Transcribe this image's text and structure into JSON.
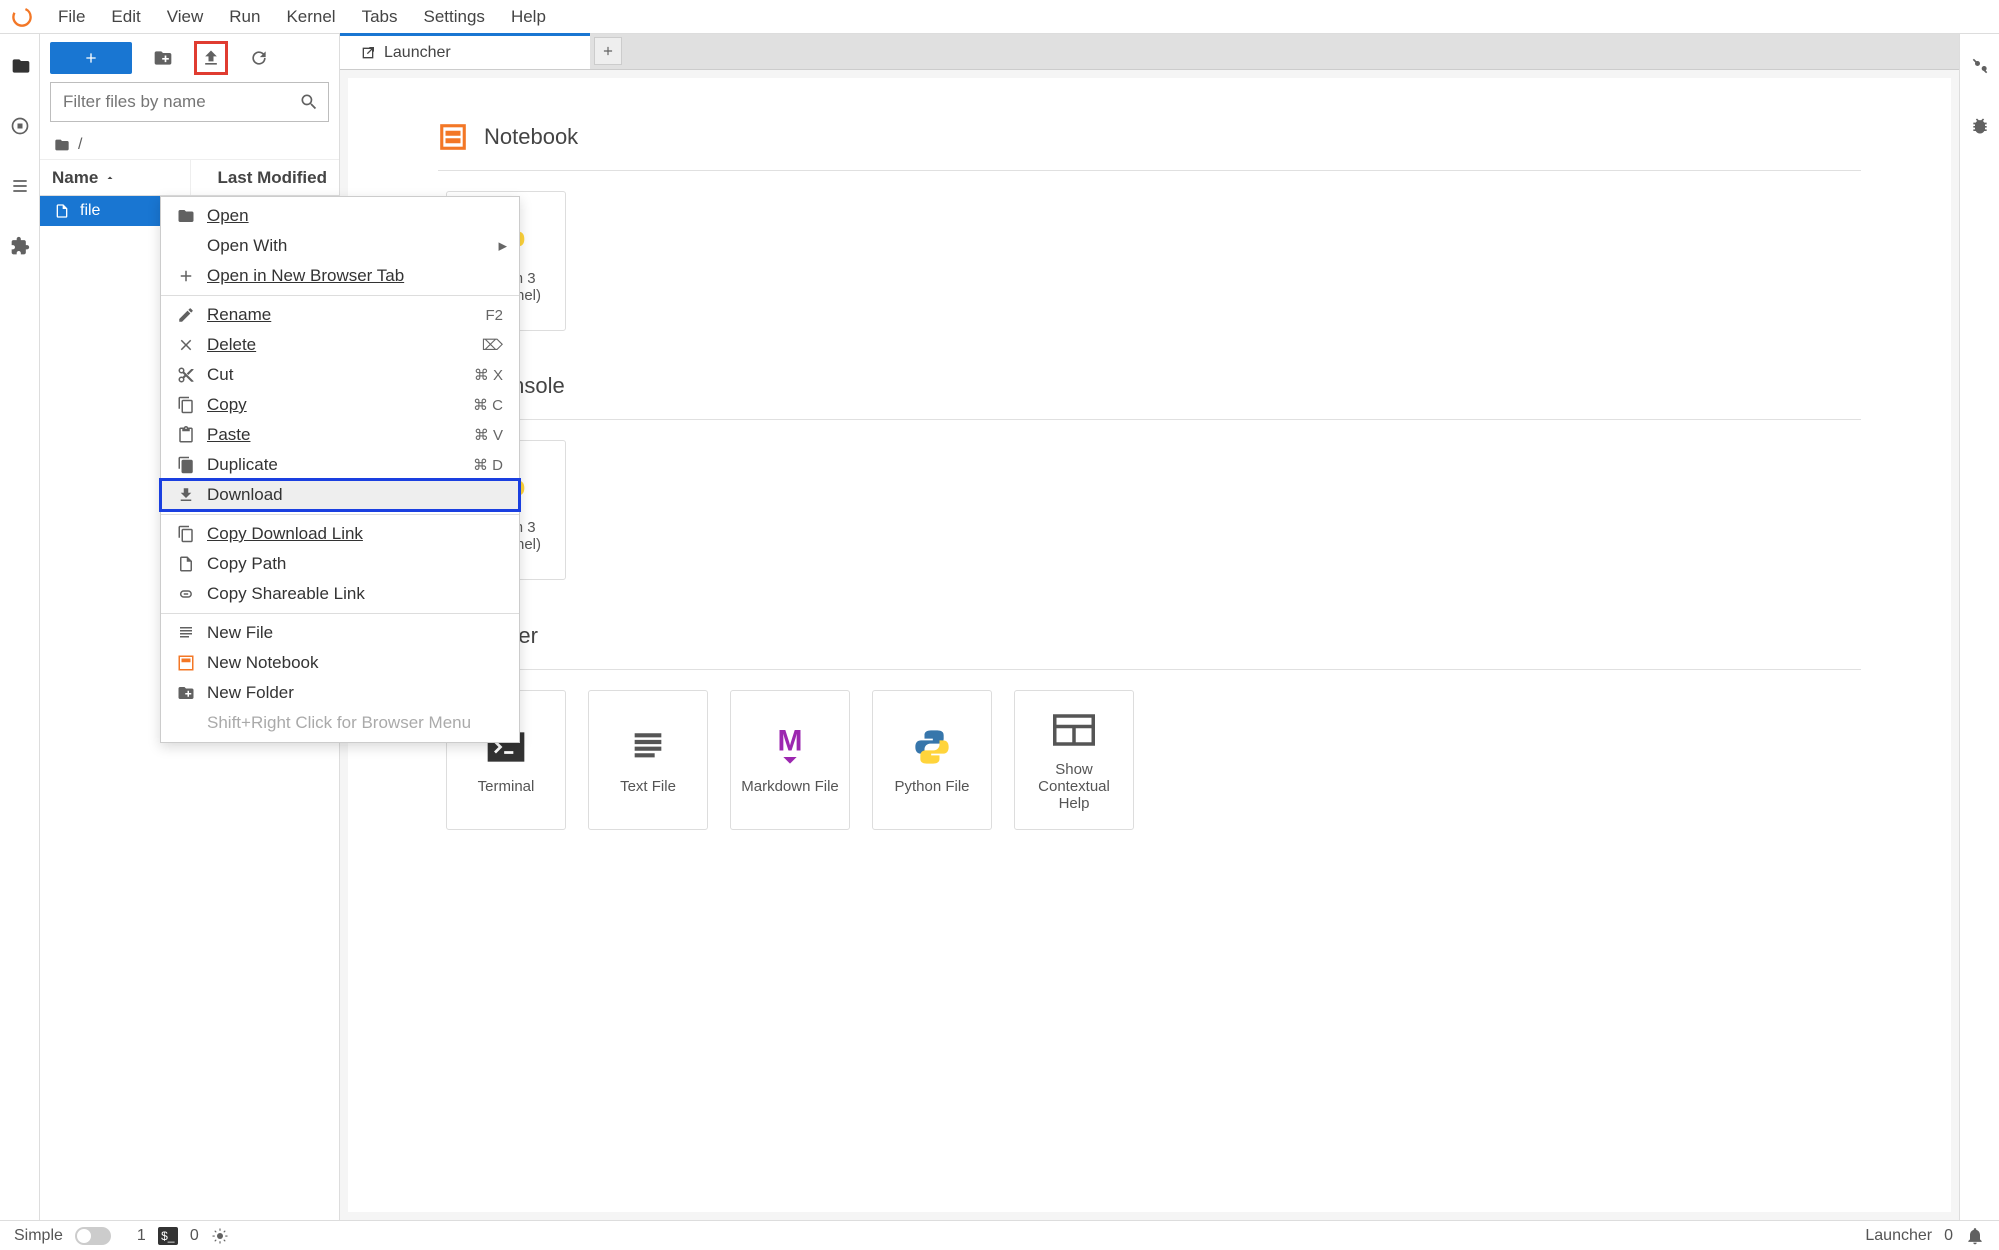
{
  "menubar": {
    "items": [
      "File",
      "Edit",
      "View",
      "Run",
      "Kernel",
      "Tabs",
      "Settings",
      "Help"
    ]
  },
  "filebrowser": {
    "filter_placeholder": "Filter files by name",
    "breadcrumb_root": "/",
    "columns": {
      "name": "Name",
      "modified": "Last Modified"
    },
    "rows": [
      {
        "name": "file"
      }
    ]
  },
  "context_menu": {
    "open": "Open",
    "open_with": "Open With",
    "open_new_tab": "Open in New Browser Tab",
    "rename": "Rename",
    "rename_sc": "F2",
    "delete": "Delete",
    "cut": "Cut",
    "cut_sc": "⌘ X",
    "copy": "Copy",
    "copy_sc": "⌘ C",
    "paste": "Paste",
    "paste_sc": "⌘ V",
    "duplicate": "Duplicate",
    "duplicate_sc": "⌘ D",
    "download": "Download",
    "copy_dl_link": "Copy Download Link",
    "copy_path": "Copy Path",
    "copy_share": "Copy Shareable Link",
    "new_file": "New File",
    "new_notebook": "New Notebook",
    "new_folder": "New Folder",
    "hint": "Shift+Right Click for Browser Menu"
  },
  "tabs": {
    "launcher": "Launcher"
  },
  "launcher": {
    "sec_notebook": "Notebook",
    "sec_console": "Console",
    "sec_other": "Other",
    "kernel1": "Python 3 (ipykernel)",
    "other": {
      "terminal": "Terminal",
      "text": "Text File",
      "markdown": "Markdown File",
      "python": "Python File",
      "help1": "Show",
      "help2": "Contextual",
      "help3": "Help"
    }
  },
  "statusbar": {
    "simple": "Simple",
    "count1": "1",
    "count2": "0",
    "right_label": "Launcher",
    "right_count": "0"
  },
  "annotations": {
    "upload_box": "red-highlight-upload",
    "download_box": "blue-highlight-download"
  }
}
